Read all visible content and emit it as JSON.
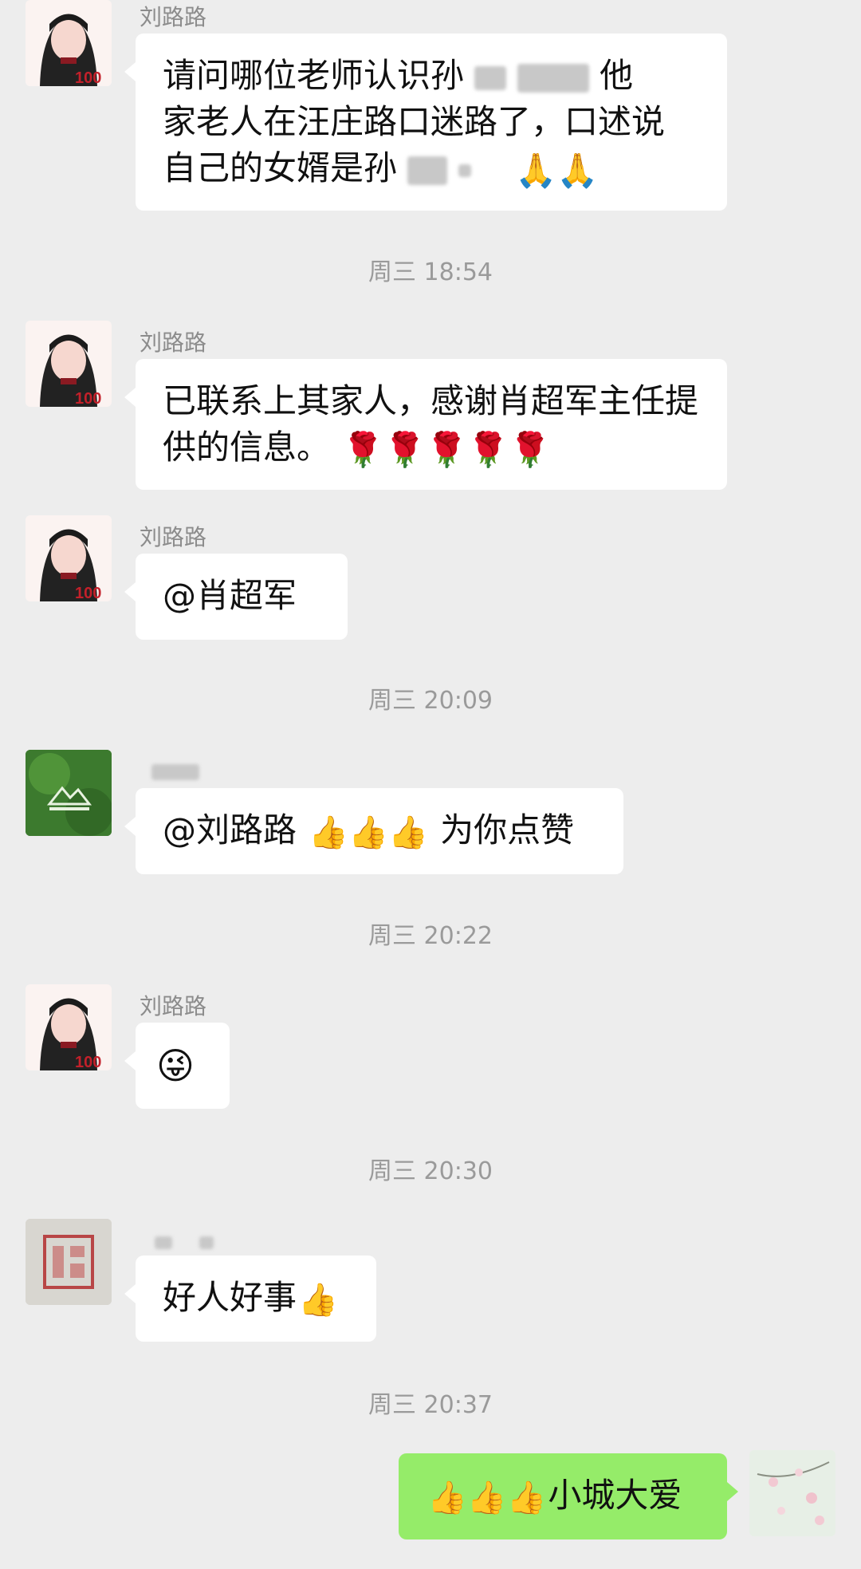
{
  "messages": [
    {
      "sender": "刘路路",
      "text_a": "请问哪位老师认识孙",
      "text_b": "他",
      "text_c": "家老人在汪庄路口迷路了，口述说",
      "text_d": "自己的女婿是孙",
      "emoji": "🙏🙏"
    },
    {
      "sender": "刘路路",
      "text": "已联系上其家人，感谢肖超军主任提供的信息。",
      "emoji": "🌹🌹🌹🌹🌹"
    },
    {
      "sender": "刘路路",
      "text": "@肖超军"
    },
    {
      "sender": "",
      "text_a": "@刘路路 ",
      "emoji": "👍👍👍",
      "text_b": "为你点赞"
    },
    {
      "sender": "刘路路",
      "emoji": "😜"
    },
    {
      "sender": "",
      "text": "好人好事",
      "emoji": "👍"
    },
    {
      "sender": "",
      "emoji": "👍👍👍",
      "text": "小城大爱"
    }
  ],
  "times": [
    "周三 18:54",
    "周三 20:09",
    "周三 20:22",
    "周三 20:30",
    "周三 20:37"
  ],
  "colors": {
    "background": "#ededed",
    "bubble": "#ffffff",
    "mine": "#95ec69",
    "time": "#9a9a9a"
  },
  "icons": [
    "avatar-girl",
    "avatar-green-logo",
    "avatar-seal",
    "avatar-blossom"
  ]
}
